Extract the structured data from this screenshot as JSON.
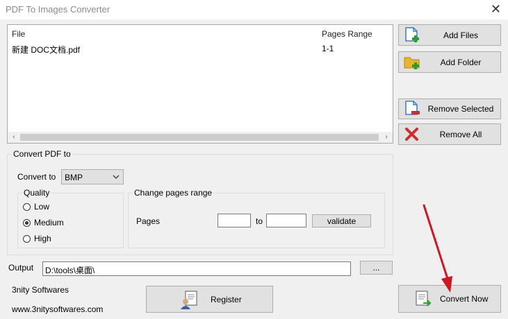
{
  "window": {
    "title": "PDF To Images Converter",
    "close_glyph": "✕"
  },
  "file_list": {
    "columns": [
      "File",
      "Pages Range"
    ],
    "rows": [
      {
        "file": "新建 DOC文档.pdf",
        "range": "1-1"
      }
    ],
    "scroll_left": "‹",
    "scroll_right": "›"
  },
  "side_buttons": {
    "add_files": "Add Files",
    "add_folder": "Add Folder",
    "remove_selected": "Remove Selected",
    "remove_all": "Remove All"
  },
  "convert_group": {
    "legend": "Convert PDF to",
    "convert_to_label": "Convert to",
    "format": "BMP",
    "quality": {
      "legend": "Quality",
      "options": [
        "Low",
        "Medium",
        "High"
      ],
      "selected": "Medium"
    },
    "pages_range": {
      "legend": "Change pages range",
      "pages_label": "Pages",
      "to_label": "to",
      "validate_label": "validate",
      "from_value": "",
      "to_value": ""
    }
  },
  "output": {
    "label": "Output",
    "path": "D:\\tools\\桌面\\",
    "browse_label": "..."
  },
  "footer": {
    "company": "3nity Softwares",
    "website": "www.3nitysoftwares.com",
    "register_label": "Register",
    "convert_label": "Convert Now"
  },
  "colors": {
    "annotation_arrow": "#d0161e",
    "plus_green": "#2e9b2e",
    "remove_red": "#d22b2b",
    "folder_yellow": "#e8b530"
  }
}
